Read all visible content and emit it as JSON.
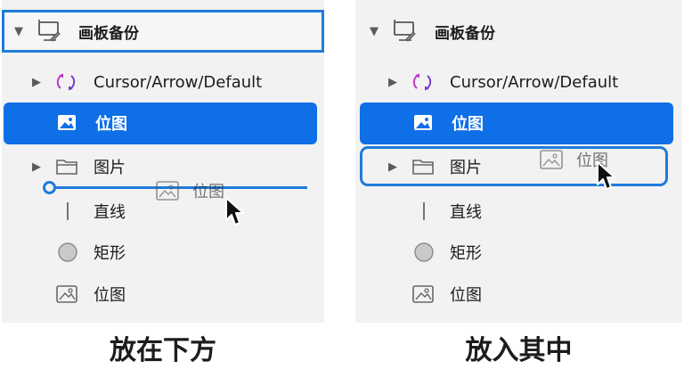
{
  "left_panel": {
    "caption": "放在下方",
    "rows": {
      "artboard_label": "画板备份",
      "cursor_label": "Cursor/Arrow/Default",
      "selected_label": "位图",
      "folder_label": "图片",
      "line_label": "直线",
      "rect_label": "矩形",
      "bitmap_label": "位图"
    },
    "drag_ghost_label": "位图"
  },
  "right_panel": {
    "caption": "放入其中",
    "rows": {
      "artboard_label": "画板备份",
      "cursor_label": "Cursor/Arrow/Default",
      "selected_label": "位图",
      "folder_label": "图片",
      "line_label": "直线",
      "rect_label": "矩形",
      "bitmap_label": "位图"
    },
    "drag_ghost_label": "位图"
  },
  "colors": {
    "accent_blue": "#0f6fe6",
    "drop_indicator": "#1f7bdc",
    "panel_bg": "#f2f2f2",
    "symbol_pink": "#c037c8",
    "symbol_purple": "#7a38d0"
  }
}
